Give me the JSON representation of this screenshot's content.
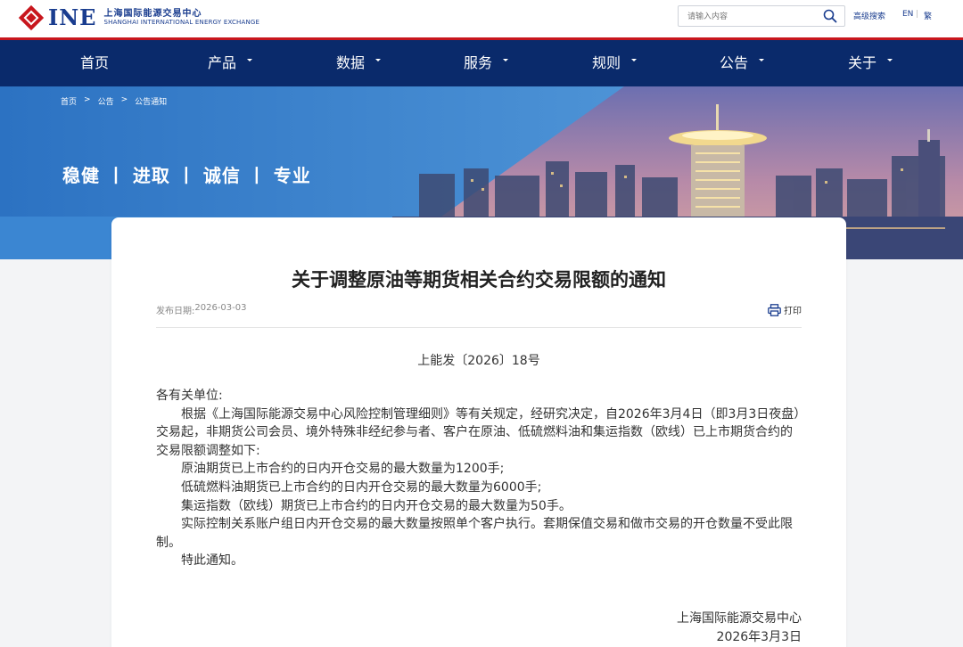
{
  "header": {
    "logo_text": "INE",
    "logo_cn": "上海国际能源交易中心",
    "logo_en": "SHANGHAI INTERNATIONAL ENERGY EXCHANGE",
    "search_placeholder": "请输入内容",
    "advanced_search": "高级搜索",
    "lang_en": "EN",
    "lang_sep": "|",
    "lang_tw": "繁"
  },
  "nav": [
    {
      "label": "首页",
      "has_dropdown": false
    },
    {
      "label": "产品",
      "has_dropdown": true
    },
    {
      "label": "数据",
      "has_dropdown": true
    },
    {
      "label": "服务",
      "has_dropdown": true
    },
    {
      "label": "规则",
      "has_dropdown": true
    },
    {
      "label": "公告",
      "has_dropdown": true
    },
    {
      "label": "关于",
      "has_dropdown": true
    }
  ],
  "breadcrumb": [
    "首页",
    ">",
    "公告",
    ">",
    "公告通知"
  ],
  "banner": {
    "slogan": "稳健 丨 进取 丨 诚信 丨 专业"
  },
  "article": {
    "title": "关于调整原油等期货相关合约交易限额的通知",
    "date_label": "发布日期: ",
    "date": "2026-03-03",
    "print_label": "打印",
    "doc_number": "上能发〔2026〕18号",
    "salutation": "各有关单位:",
    "paragraphs": [
      "根据《上海国际能源交易中心风险控制管理细则》等有关规定，经研究决定，自2026年3月4日（即3月3日夜盘）交易起，非期货公司会员、境外特殊非经纪参与者、客户在原油、低硫燃料油和集运指数（欧线）已上市期货合约的交易限额调整如下:",
      "原油期货已上市合约的日内开仓交易的最大数量为1200手;",
      "低硫燃料油期货已上市合约的日内开仓交易的最大数量为6000手;",
      "集运指数（欧线）期货已上市合约的日内开仓交易的最大数量为50手。",
      "实际控制关系账户组日内开仓交易的最大数量按照单个客户执行。套期保值交易和做市交易的开仓数量不受此限制。",
      "特此通知。"
    ],
    "signature_org": "上海国际能源交易中心",
    "signature_date": "2026年3月3日"
  },
  "colors": {
    "brand_red": "#c8161d",
    "brand_blue": "#1a3d8f",
    "nav_bg": "#0a2a6b"
  },
  "icons": {
    "search": "search-icon",
    "print": "printer-icon",
    "logo": "ine-diamond-logo-icon"
  }
}
